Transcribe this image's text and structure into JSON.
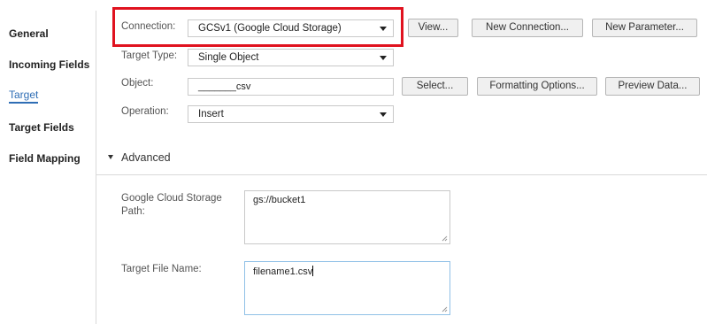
{
  "sidebar": {
    "items": [
      {
        "label": "General"
      },
      {
        "label": "Incoming Fields"
      },
      {
        "label": "Target"
      },
      {
        "label": "Target Fields"
      },
      {
        "label": "Field Mapping"
      }
    ]
  },
  "form": {
    "connection": {
      "label": "Connection:",
      "value": "GCSv1 (Google Cloud Storage)"
    },
    "target_type": {
      "label": "Target Type:",
      "value": "Single Object"
    },
    "object": {
      "label": "Object:",
      "value": "_______csv"
    },
    "operation": {
      "label": "Operation:",
      "value": "Insert"
    }
  },
  "buttons": {
    "view": "View...",
    "new_connection": "New Connection...",
    "new_parameter": "New Parameter...",
    "select": "Select...",
    "formatting_options": "Formatting Options...",
    "preview_data": "Preview Data..."
  },
  "advanced": {
    "title": "Advanced",
    "gcs_path": {
      "label": "Google Cloud Storage Path:",
      "value": "gs://bucket1"
    },
    "target_file_name": {
      "label": "Target File Name:",
      "value": "filename1.csv"
    }
  },
  "colors": {
    "highlight": "#e0121f",
    "active_nav": "#2f6eb5"
  }
}
